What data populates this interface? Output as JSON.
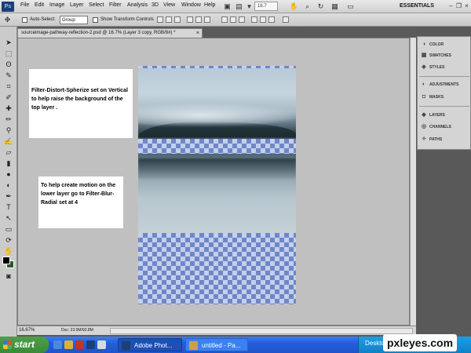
{
  "app": {
    "logo_text": "Ps",
    "menu": [
      "File",
      "Edit",
      "Image",
      "Layer",
      "Select",
      "Filter",
      "Analysis",
      "3D",
      "View",
      "Window",
      "Help"
    ],
    "zoom_display": "16.7",
    "workspace": "ESSENTIALS"
  },
  "options_bar": {
    "auto_select_label": "Auto-Select:",
    "auto_select_value": "Group",
    "show_transform_label": "Show Transform Controls"
  },
  "document": {
    "tab_title": "sourceimage-pathway-reflection-2.psd @ 16.7% (Layer 3 copy, RGB/8#) *",
    "close_glyph": "×"
  },
  "notes": {
    "note1": "Filter-Distort-Spherize set on Vertical to help raise the background of the top layer .",
    "note2": "To help create motion on the lower layer go to Filter-Blur-Radial set at 4"
  },
  "status": {
    "zoom": "16.67%",
    "doc_size": "Doc: 23.9M/92.8M"
  },
  "panels": {
    "items": [
      {
        "icon": "color-icon",
        "label": "COLOR"
      },
      {
        "icon": "swatches-icon",
        "label": "SWATCHES"
      },
      {
        "icon": "styles-icon",
        "label": "STYLES"
      },
      {
        "icon": "adjustments-icon",
        "label": "ADJUSTMENTS"
      },
      {
        "icon": "masks-icon",
        "label": "MASKS"
      },
      {
        "icon": "layers-icon",
        "label": "LAYERS"
      },
      {
        "icon": "channels-icon",
        "label": "CHANNELS"
      },
      {
        "icon": "paths-icon",
        "label": "PATHS"
      }
    ]
  },
  "taskbar": {
    "start": "start",
    "tasks": [
      {
        "label": "Adobe Phot...",
        "icon_color": "#1d3f77"
      },
      {
        "label": "untitled - Pa...",
        "icon_color": "#c8a24a"
      }
    ],
    "tray_label": "Desktop"
  },
  "watermark": "pxleyes.com"
}
